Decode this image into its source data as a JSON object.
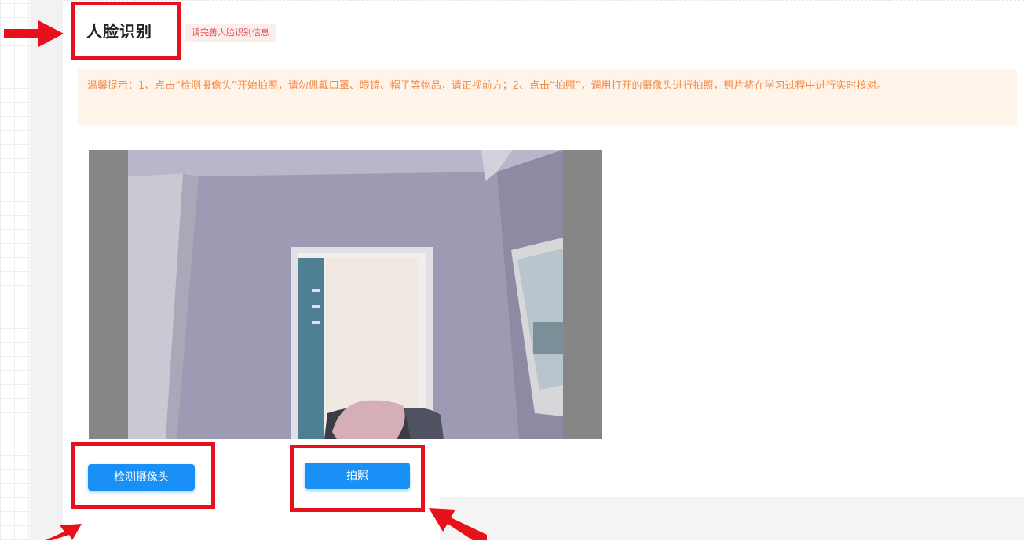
{
  "section": {
    "title": "人脸识别",
    "notice_tag": "请完善人脸识别信息"
  },
  "tip": {
    "text": "温馨提示：1、点击“检测摄像头”开始拍照，请勿佩戴口罩、眼镜、帽子等物品，请正视前方；2、点击“拍照”，调用打开的摄像头进行拍照，照片将在学习过程中进行实时核对。"
  },
  "buttons": {
    "detect_camera": "检测摄像头",
    "take_photo": "拍照"
  },
  "colors": {
    "primary_button": "#1890f5",
    "highlight_red": "#e8111b",
    "tip_text": "#f18a46",
    "tip_background": "#fff4ea",
    "notice_text": "#e2504c"
  }
}
